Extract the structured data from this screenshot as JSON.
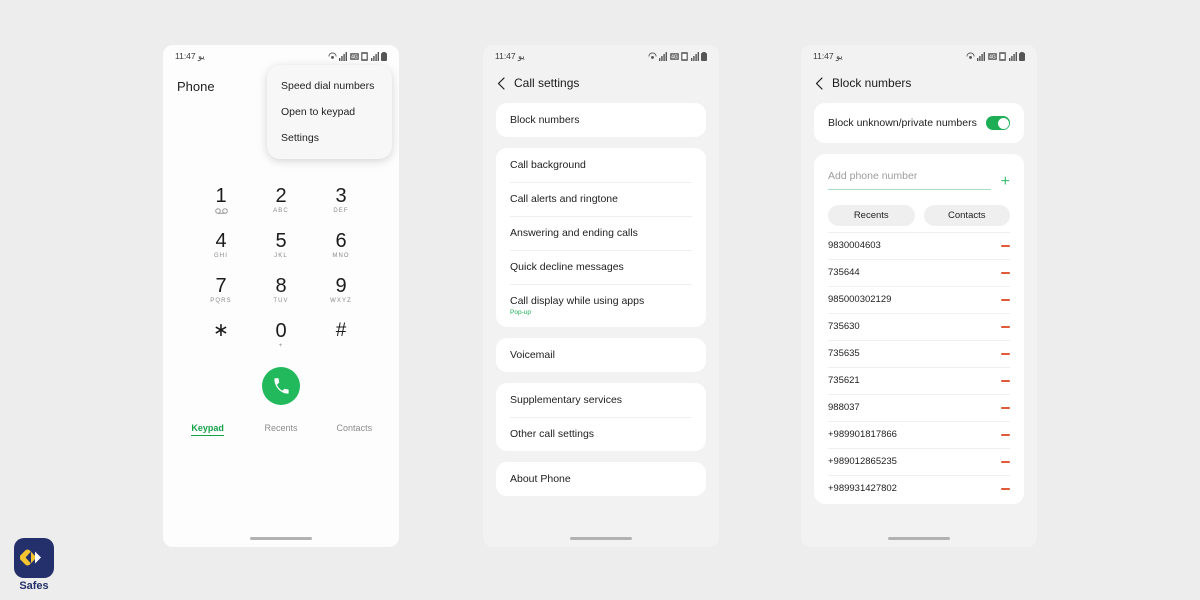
{
  "colors": {
    "page_background": "#EDEDED",
    "accent_green": "#21B95C",
    "toggle_green": "#1DAE56",
    "remove_red": "#E2593A",
    "brand_navy": "#23306B",
    "brand_yellow": "#F5C431"
  },
  "phone1": {
    "status": {
      "time": "11:47",
      "time_suffix": "یو",
      "icons": [
        "wifi-calling-icon",
        "signal-icon",
        "network-icon",
        "sim-icon",
        "signal-icon",
        "battery-icon"
      ]
    },
    "title": "Phone",
    "menu": {
      "items": [
        {
          "label": "Speed dial numbers"
        },
        {
          "label": "Open to keypad"
        },
        {
          "label": "Settings"
        }
      ]
    },
    "keypad": [
      {
        "digit": "1",
        "sub": "",
        "voicemail": true
      },
      {
        "digit": "2",
        "sub": "ABC"
      },
      {
        "digit": "3",
        "sub": "DEF"
      },
      {
        "digit": "4",
        "sub": "GHI"
      },
      {
        "digit": "5",
        "sub": "JKL"
      },
      {
        "digit": "6",
        "sub": "MNO"
      },
      {
        "digit": "7",
        "sub": "PQRS"
      },
      {
        "digit": "8",
        "sub": "TUV"
      },
      {
        "digit": "9",
        "sub": "WXYZ"
      },
      {
        "digit": "∗",
        "sub": "",
        "symbol": true
      },
      {
        "digit": "0",
        "sub": "+"
      },
      {
        "digit": "#",
        "sub": "",
        "symbol": true
      }
    ],
    "call_button": "call-icon",
    "tabs": [
      {
        "label": "Keypad",
        "active": true
      },
      {
        "label": "Recents",
        "active": false
      },
      {
        "label": "Contacts",
        "active": false
      }
    ]
  },
  "phone2": {
    "status": {
      "time": "11:47",
      "time_suffix": "یو"
    },
    "title": "Call settings",
    "groups": [
      {
        "rows": [
          {
            "label": "Block numbers"
          }
        ]
      },
      {
        "rows": [
          {
            "label": "Call background"
          },
          {
            "label": "Call alerts and ringtone"
          },
          {
            "label": "Answering and ending calls"
          },
          {
            "label": "Quick decline messages"
          },
          {
            "label": "Call display while using apps",
            "sub": "Pop-up"
          }
        ]
      },
      {
        "rows": [
          {
            "label": "Voicemail"
          }
        ]
      },
      {
        "rows": [
          {
            "label": "Supplementary services"
          },
          {
            "label": "Other call settings"
          }
        ]
      },
      {
        "rows": [
          {
            "label": "About Phone"
          }
        ]
      }
    ]
  },
  "phone3": {
    "status": {
      "time": "11:47",
      "time_suffix": "یو"
    },
    "title": "Block numbers",
    "toggle": {
      "label": "Block unknown/private numbers",
      "on": true
    },
    "add_field": {
      "value": "",
      "placeholder": "Add phone number",
      "add_icon": "plus-icon"
    },
    "segments": [
      {
        "label": "Recents"
      },
      {
        "label": "Contacts"
      }
    ],
    "numbers": [
      {
        "number": "9830004603"
      },
      {
        "number": "735644"
      },
      {
        "number": "985000302129"
      },
      {
        "number": "735630"
      },
      {
        "number": "735635"
      },
      {
        "number": "735621"
      },
      {
        "number": "988037"
      },
      {
        "number": "+989901817866"
      },
      {
        "number": "+989012865235"
      },
      {
        "number": "+989931427802"
      }
    ]
  },
  "brand": {
    "name": "Safes"
  }
}
